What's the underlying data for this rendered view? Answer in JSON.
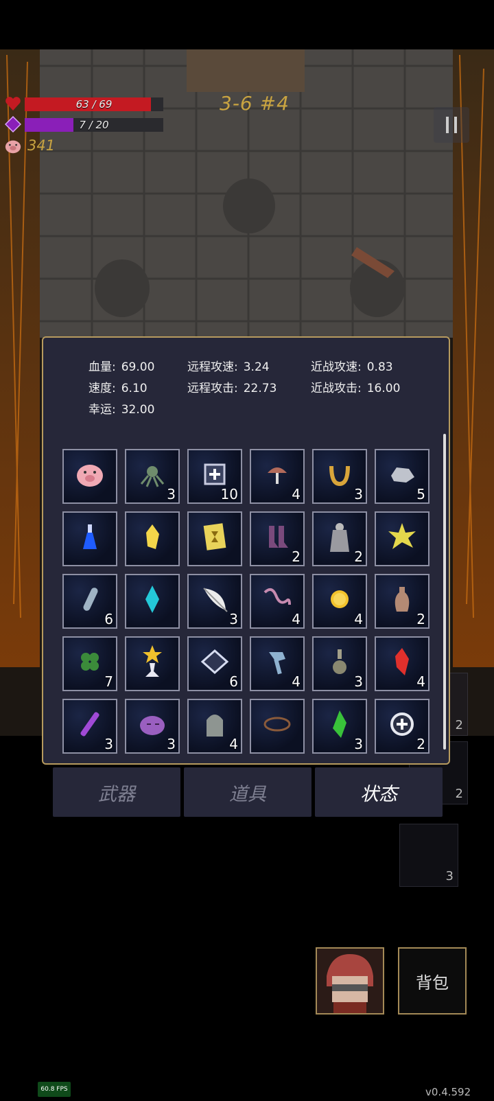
{
  "hud": {
    "hp_text": "63 / 69",
    "hp_fraction": 0.913,
    "mana_text": "7 / 20",
    "mana_fraction": 0.35,
    "coins": "341",
    "level": "3-6 #4",
    "colors": {
      "hp": "#c41a22",
      "mana": "#8a1fb8",
      "gold": "#c9a441"
    }
  },
  "stats": [
    {
      "label": "血量:",
      "value": "69.00"
    },
    {
      "label": "远程攻速:",
      "value": "3.24"
    },
    {
      "label": "近战攻速:",
      "value": "0.83"
    },
    {
      "label": "速度:",
      "value": "6.10"
    },
    {
      "label": "远程攻击:",
      "value": "22.73"
    },
    {
      "label": "近战攻击:",
      "value": "16.00"
    },
    {
      "label": "幸运:",
      "value": "32.00"
    }
  ],
  "items": [
    {
      "icon": "piggy-bank-icon",
      "count": ""
    },
    {
      "icon": "octopus-icon",
      "count": "3"
    },
    {
      "icon": "medkit-icon",
      "count": "10"
    },
    {
      "icon": "mushroom-icon",
      "count": "4"
    },
    {
      "icon": "horseshoe-icon",
      "count": "3"
    },
    {
      "icon": "rock-icon",
      "count": "5"
    },
    {
      "icon": "blue-potion-icon",
      "count": ""
    },
    {
      "icon": "yellow-crystal-icon",
      "count": ""
    },
    {
      "icon": "hourglass-card-icon",
      "count": ""
    },
    {
      "icon": "boots-icon",
      "count": "2"
    },
    {
      "icon": "cloak-icon",
      "count": "2"
    },
    {
      "icon": "spiked-star-icon",
      "count": ""
    },
    {
      "icon": "vial-icon",
      "count": "6"
    },
    {
      "icon": "cyan-crystal-icon",
      "count": ""
    },
    {
      "icon": "feather-icon",
      "count": "3"
    },
    {
      "icon": "worm-icon",
      "count": "4"
    },
    {
      "icon": "gold-coin-icon",
      "count": "4"
    },
    {
      "icon": "vase-icon",
      "count": "2"
    },
    {
      "icon": "clover-icon",
      "count": "7"
    },
    {
      "icon": "trophy-icon",
      "count": ""
    },
    {
      "icon": "rhombus-tile-icon",
      "count": "6"
    },
    {
      "icon": "hammer-icon",
      "count": "4"
    },
    {
      "icon": "flask-icon",
      "count": "3"
    },
    {
      "icon": "red-crystal-icon",
      "count": "4"
    },
    {
      "icon": "test-tube-icon",
      "count": "3"
    },
    {
      "icon": "slime-icon",
      "count": "3"
    },
    {
      "icon": "tombstone-icon",
      "count": "4"
    },
    {
      "icon": "thorn-crown-icon",
      "count": ""
    },
    {
      "icon": "green-crystal-icon",
      "count": "3"
    },
    {
      "icon": "heal-ring-icon",
      "count": "2"
    }
  ],
  "tabs": [
    {
      "label": "武器",
      "active": false
    },
    {
      "label": "道具",
      "active": false
    },
    {
      "label": "状态",
      "active": true
    }
  ],
  "side_slots": [
    {
      "count": "2"
    },
    {
      "count": "2"
    },
    {
      "count": "3"
    }
  ],
  "bag_label": "背包",
  "fps": "60.8 FPS",
  "version": "v0.4.592"
}
